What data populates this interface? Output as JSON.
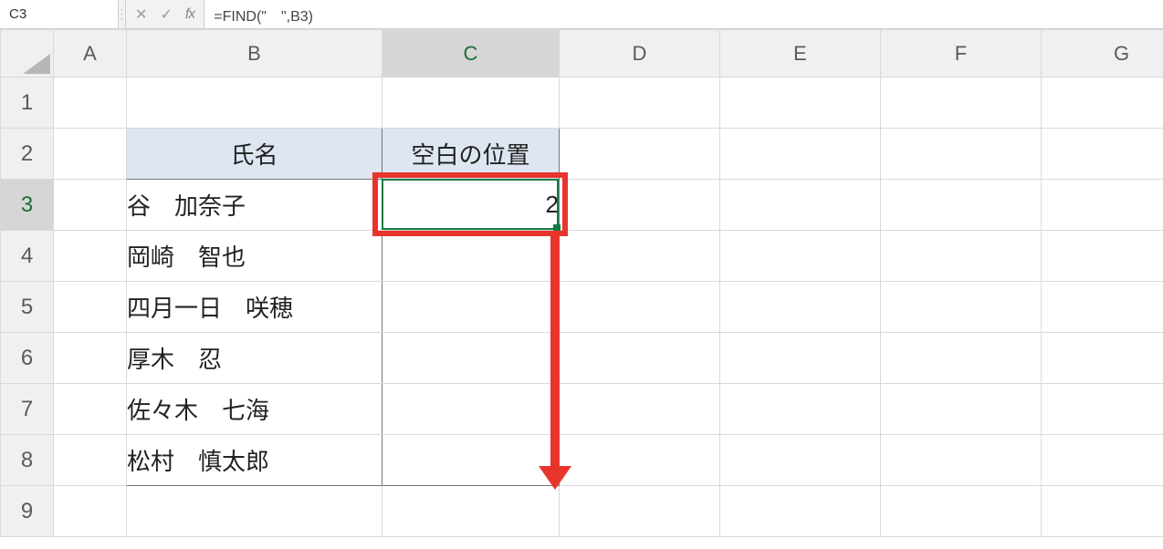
{
  "formula_bar": {
    "name_box": "C3",
    "formula": "=FIND(\"　\",B3)",
    "cancel_glyph": "✕",
    "enter_glyph": "✓",
    "fx_glyph": "fx",
    "dropdown_glyph": "▾",
    "divider_glyph": "⋮"
  },
  "columns": [
    "A",
    "B",
    "C",
    "D",
    "E",
    "F",
    "G"
  ],
  "rows": [
    "1",
    "2",
    "3",
    "4",
    "5",
    "6",
    "7",
    "8",
    "9"
  ],
  "active_cell": {
    "col": "C",
    "row": "3"
  },
  "table": {
    "headers": {
      "B": "氏名",
      "C": "空白の位置"
    },
    "rows": [
      {
        "B": "谷　加奈子",
        "C": "2"
      },
      {
        "B": "岡崎　智也",
        "C": ""
      },
      {
        "B": "四月一日　咲穂",
        "C": ""
      },
      {
        "B": "厚木　忍",
        "C": ""
      },
      {
        "B": "佐々木　七海",
        "C": ""
      },
      {
        "B": "松村　慎太郎",
        "C": ""
      }
    ]
  }
}
